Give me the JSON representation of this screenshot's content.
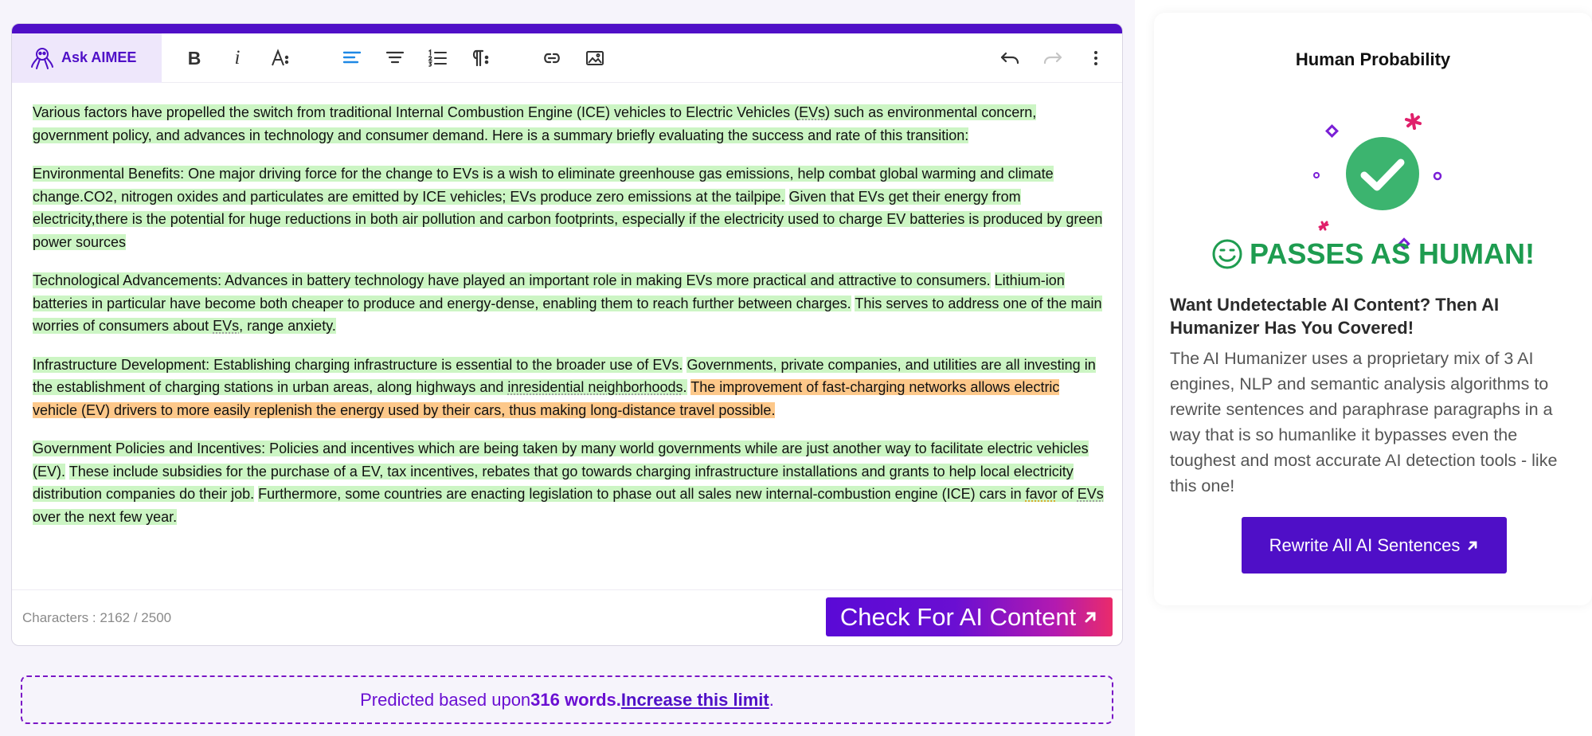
{
  "toolbar": {
    "ask_label": "Ask AIMEE"
  },
  "editor": {
    "paragraphs": [
      {
        "segments": [
          {
            "text": "Various factors have propelled the switch from traditional Internal Combustion Engine (ICE) vehicles to Electric Vehicles (",
            "hl": "green"
          },
          {
            "text": "EVs",
            "hl": "green",
            "ul": "grey"
          },
          {
            "text": ") such as environmental concern, government policy, and advances in technology and consumer demand. Here is a summary briefly evaluating the success and rate of this transition:",
            "hl": "green"
          }
        ]
      },
      {
        "segments": [
          {
            "text": "Environmental Benefits: ",
            "hl": "green"
          },
          {
            "text": "One major driving force for the change to EVs is a wish to eliminate greenhouse gas emissions, help combat global warming and climate change.CO2, nitrogen oxides and particulates are emitted by ICE vehicles; EVs produce zero emissions at the tailpipe.",
            "hl": "green"
          },
          {
            "text": " ",
            "hl": ""
          },
          {
            "text": "Given that EVs get their energy from electricity,there is the potential for huge reductions in both air pollution and carbon footprints, especially if the electricity used to charge EV batteries is produced by green power sources",
            "hl": "green"
          }
        ]
      },
      {
        "segments": [
          {
            "text": "Technological Advancements: ",
            "hl": "green"
          },
          {
            "text": "Advances in battery technology have played an important role in making EVs more practical and attractive to consumers.",
            "hl": "green"
          },
          {
            "text": " ",
            "hl": ""
          },
          {
            "text": "Lithium-ion batteries in particular have become both cheaper to produce and energy-dense, enabling them to reach further between charges.",
            "hl": "green"
          },
          {
            "text": " ",
            "hl": ""
          },
          {
            "text": "This serves to address one of the main worries of consumers about ",
            "hl": "green"
          },
          {
            "text": "EVs",
            "hl": "green",
            "ul": "grey"
          },
          {
            "text": ", range anxiety.",
            "hl": "green"
          }
        ]
      },
      {
        "segments": [
          {
            "text": "Infrastructure Development: ",
            "hl": "green"
          },
          {
            "text": "Establishing charging infrastructure is essential to the broader use of EVs.",
            "hl": "green"
          },
          {
            "text": " ",
            "hl": ""
          },
          {
            "text": "Governments, private companies, and utilities are all investing in the establishment of charging stations in urban areas, along highways and ",
            "hl": "green"
          },
          {
            "text": "inresidential neighborhoods",
            "hl": "green",
            "ul": "grey"
          },
          {
            "text": ".",
            "hl": "green"
          },
          {
            "text": " ",
            "hl": ""
          },
          {
            "text": "The improvement of fast-charging networks allows electric vehicle (EV) drivers to more easily replenish the energy used by their cars, thus making long-distance travel possible.",
            "hl": "orange"
          }
        ]
      },
      {
        "segments": [
          {
            "text": "Government Policies and Incentives: ",
            "hl": "green"
          },
          {
            "text": "Policies and incentives which are being taken by many world governments while are just another way to facilitate electric vehicles (EV).",
            "hl": "green"
          },
          {
            "text": " ",
            "hl": ""
          },
          {
            "text": "These include subsidies for the purchase of a EV, tax incentives, rebates that go towards charging infrastructure installations and grants to help local electricity distribution companies do their job.",
            "hl": "green"
          },
          {
            "text": " ",
            "hl": ""
          },
          {
            "text": "Furthermore, some countries are enacting legislation to phase out all sales new internal-combustion engine (ICE) cars in ",
            "hl": "green"
          },
          {
            "text": "favor",
            "hl": "green",
            "ul": "warn"
          },
          {
            "text": " of ",
            "hl": "green"
          },
          {
            "text": "EVs",
            "hl": "green",
            "ul": "grey"
          },
          {
            "text": " over the next few year.",
            "hl": "green"
          }
        ]
      }
    ],
    "char_label": "Characters : ",
    "char_count": "2162",
    "char_limit": " / 2500",
    "check_button": "Check For AI Content"
  },
  "prediction": {
    "prefix": "Predicted based upon ",
    "words": "316 words.",
    "space": " ",
    "link": "Increase this limit",
    "suffix": "."
  },
  "panel": {
    "title": "Human Probability",
    "result": "PASSES AS HUMAN!",
    "heading": "Want Undetectable AI Content? Then AI Humanizer Has You Covered!",
    "body": "The AI Humanizer uses a proprietary mix of 3 AI engines, NLP and semantic analysis algorithms to rewrite sentences and paraphrase paragraphs in a way that is so humanlike it bypasses even the toughest and most accurate AI detection tools - like this one!",
    "rewrite_button": "Rewrite All AI Sentences"
  },
  "colors": {
    "brand": "#4f0fc7",
    "highlight_human": "#ccf5c4",
    "highlight_ai": "#fdc88a",
    "pass": "#1e9c50"
  },
  "icons": [
    "ai-octopus-icon",
    "bold-icon",
    "italic-icon",
    "font-size-icon",
    "align-left-icon",
    "align-center-icon",
    "numbered-list-icon",
    "paragraph-icon",
    "link-icon",
    "image-icon",
    "undo-icon",
    "redo-icon",
    "more-vertical-icon",
    "check-circle-icon",
    "smiley-icon",
    "arrow-up-right-icon"
  ]
}
